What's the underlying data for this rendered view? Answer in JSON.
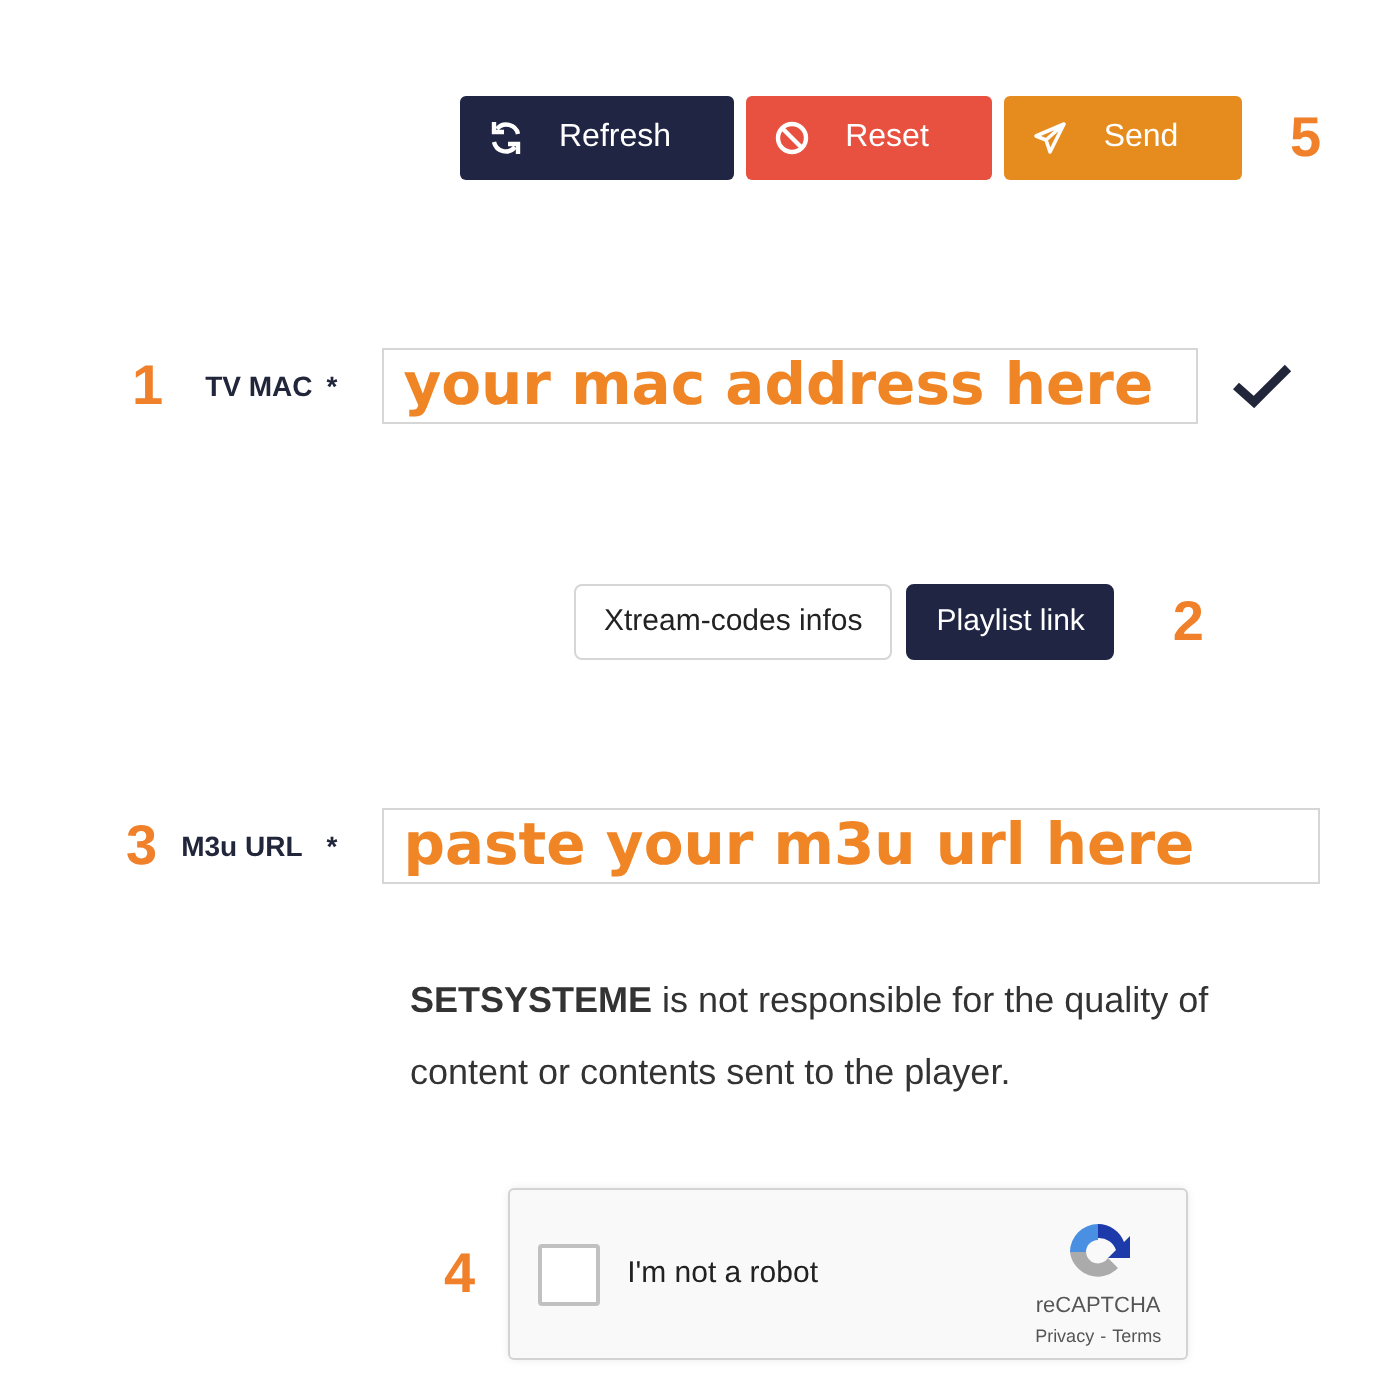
{
  "actions": {
    "step": "5",
    "buttons": [
      {
        "kind": "refresh",
        "label": "Refresh"
      },
      {
        "kind": "reset",
        "label": "Reset"
      },
      {
        "kind": "send",
        "label": "Send"
      }
    ]
  },
  "mac": {
    "step": "1",
    "label": "TV MAC",
    "required": "*",
    "value": "your mac address here",
    "verified": true
  },
  "source": {
    "step": "2",
    "options": [
      {
        "label": "Xtream-codes infos",
        "selected": false
      },
      {
        "label": "Playlist link",
        "selected": true
      }
    ]
  },
  "url": {
    "step": "3",
    "label": "M3u URL",
    "required": "*",
    "value": "paste your m3u url here"
  },
  "notice": "**SETSYSTEME** is not responsible for the quality of content or contents sent to the player.",
  "captcha": {
    "step": "4",
    "label": "I'm not a robot",
    "checked": false,
    "brand": "reCAPTCHA",
    "privacy": "Privacy",
    "separator": "-",
    "terms": "Terms"
  }
}
